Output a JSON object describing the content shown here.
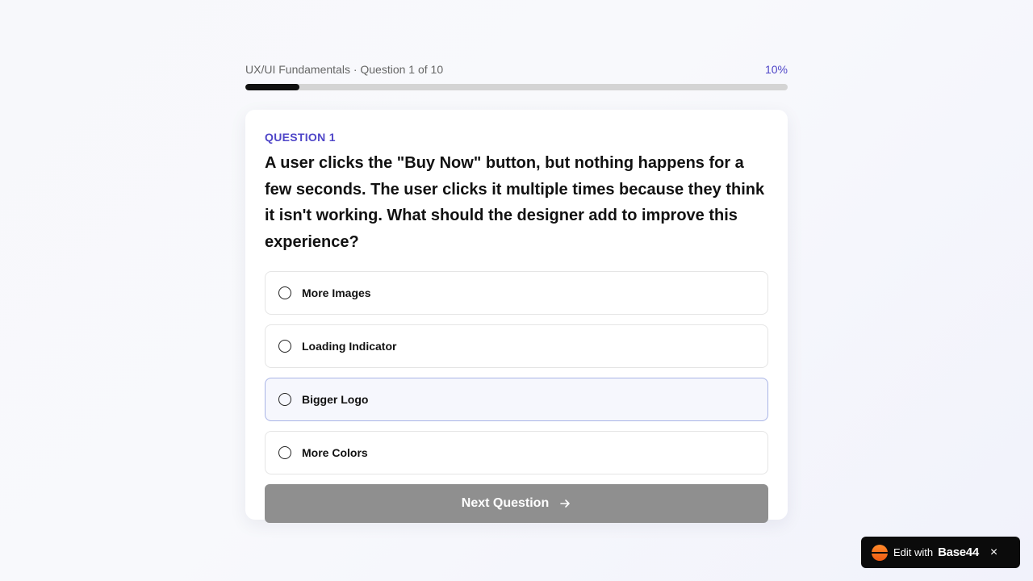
{
  "progress": {
    "label": "UX/UI Fundamentals · Question 1 of 10",
    "percent_text": "10%",
    "fraction": 0.1,
    "fill_color": "#111111",
    "accent_color": "#4f46c8"
  },
  "question": {
    "kicker": "QUESTION 1",
    "text": "A user clicks the \"Buy Now\" button, but nothing happens for a few seconds. The user clicks it multiple times because they think it isn't working. What should the designer add to improve this experience?"
  },
  "options": [
    {
      "label": "More Images"
    },
    {
      "label": "Loading Indicator"
    },
    {
      "label": "Bigger Logo"
    },
    {
      "label": "More Colors"
    }
  ],
  "next_button": {
    "label": "Next Question",
    "icon": "arrow-right-icon"
  },
  "badge": {
    "text": "Edit with",
    "brand": "Base44",
    "close": "×",
    "logo_icon": "base44-logo-icon",
    "close_icon": "close-icon"
  }
}
